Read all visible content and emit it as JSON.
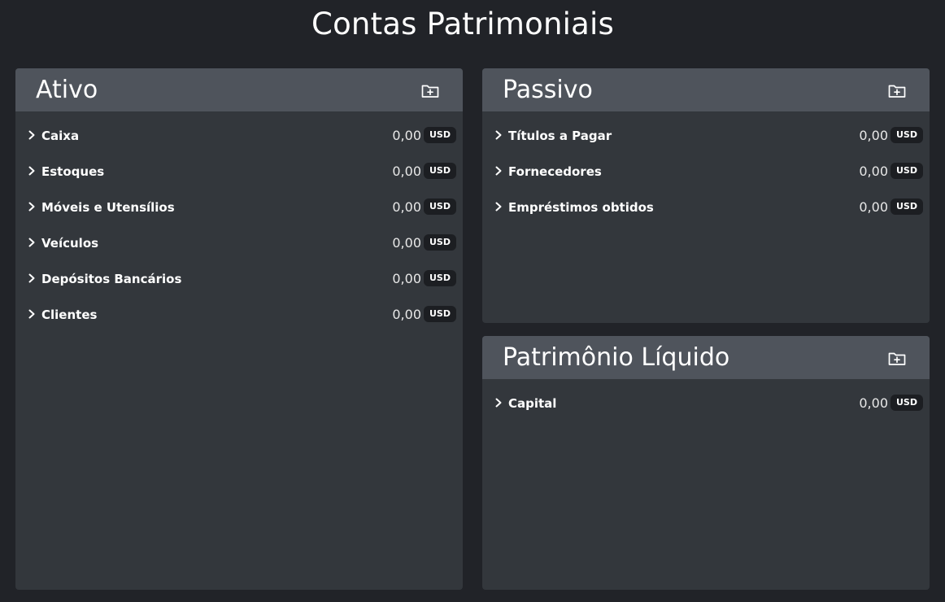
{
  "page_title": "Contas Patrimoniais",
  "icons": {
    "add_folder": "folder-plus-icon",
    "expand": "chevron-right-icon"
  },
  "colors": {
    "background": "#212328",
    "panel": "#33373c",
    "panel_header": "#4f545c",
    "badge": "#1c1e22",
    "text": "#ffffff"
  },
  "panels": [
    {
      "title": "Ativo",
      "accounts": [
        {
          "name": "Caixa",
          "amount": "0,00",
          "currency": "USD"
        },
        {
          "name": "Estoques",
          "amount": "0,00",
          "currency": "USD"
        },
        {
          "name": "Móveis e Utensílios",
          "amount": "0,00",
          "currency": "USD"
        },
        {
          "name": "Veículos",
          "amount": "0,00",
          "currency": "USD"
        },
        {
          "name": "Depósitos Bancários",
          "amount": "0,00",
          "currency": "USD"
        },
        {
          "name": "Clientes",
          "amount": "0,00",
          "currency": "USD"
        }
      ]
    },
    {
      "title": "Passivo",
      "accounts": [
        {
          "name": "Títulos a Pagar",
          "amount": "0,00",
          "currency": "USD"
        },
        {
          "name": "Fornecedores",
          "amount": "0,00",
          "currency": "USD"
        },
        {
          "name": "Empréstimos obtidos",
          "amount": "0,00",
          "currency": "USD"
        }
      ]
    },
    {
      "title": "Patrimônio Líquido",
      "accounts": [
        {
          "name": "Capital",
          "amount": "0,00",
          "currency": "USD"
        }
      ]
    }
  ]
}
